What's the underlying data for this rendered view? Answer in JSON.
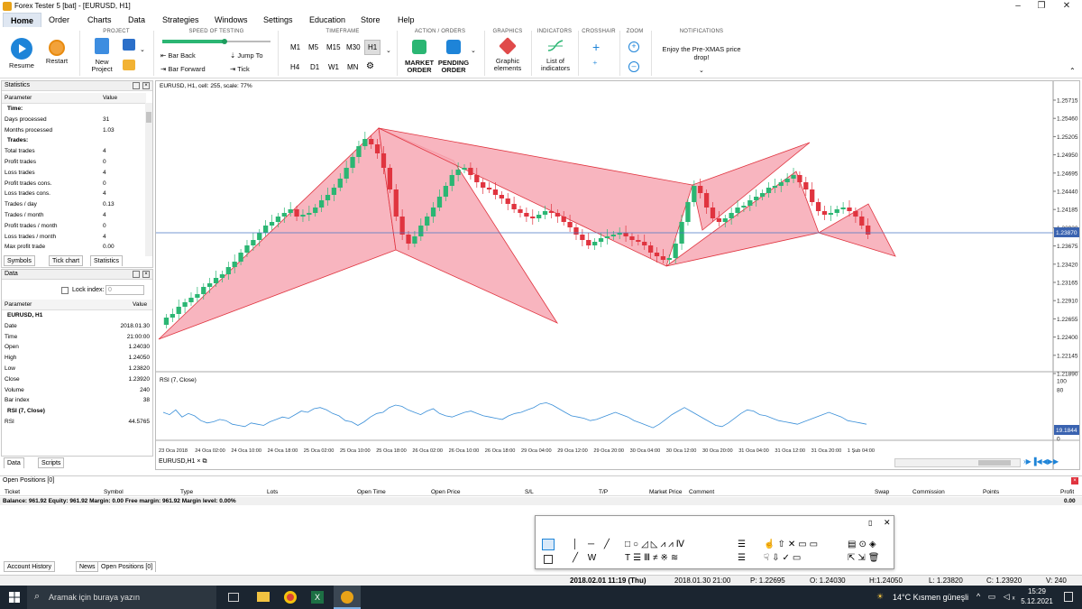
{
  "window": {
    "title": "Forex Tester 5  [bat] - [EURUSD, H1]"
  },
  "menu": [
    "Home",
    "Order",
    "Charts",
    "Data",
    "Strategies",
    "Windows",
    "Settings",
    "Education",
    "Store",
    "Help"
  ],
  "ribbon": {
    "groups": {
      "project": "PROJECT",
      "speed": "SPEED OF TESTING",
      "timeframe": "TIMEFRAME",
      "action": "ACTION / ORDERS",
      "graphics": "GRAPHICS",
      "indicators": "INDICATORS",
      "crosshair": "CROSSHAIR",
      "zoom": "ZOOM",
      "notifications": "NOTIFICATIONS"
    },
    "resume": "Resume",
    "restart": "Restart",
    "new_project": [
      "New",
      "Project"
    ],
    "bar_back": "Bar Back",
    "bar_forward": "Bar Forward",
    "jump_to": "Jump To",
    "tick": "Tick",
    "timeframes_row1": [
      "M1",
      "M5",
      "M15",
      "M30",
      "H1"
    ],
    "timeframes_row2": [
      "H4",
      "D1",
      "W1",
      "MN"
    ],
    "market_order": [
      "MARKET",
      "ORDER"
    ],
    "pending_order": [
      "PENDING",
      "ORDER"
    ],
    "graphic_elements": [
      "Graphic",
      "elements"
    ],
    "list_indicators": [
      "List of",
      "indicators"
    ],
    "notification": [
      "Enjoy the Pre-XMAS price",
      "drop!"
    ]
  },
  "statistics": {
    "title": "Statistics",
    "col_param": "Parameter",
    "col_value": "Value",
    "rows": [
      {
        "k": "Time:",
        "v": "",
        "h": true
      },
      {
        "k": "Days processed",
        "v": "31"
      },
      {
        "k": "Months processed",
        "v": "1.03"
      },
      {
        "k": "Trades:",
        "v": "",
        "h": true
      },
      {
        "k": "Total trades",
        "v": "4"
      },
      {
        "k": "Profit trades",
        "v": "0"
      },
      {
        "k": "Loss trades",
        "v": "4"
      },
      {
        "k": "Profit trades cons.",
        "v": "0"
      },
      {
        "k": "Loss trades cons.",
        "v": "4"
      },
      {
        "k": "Trades / day",
        "v": "0.13"
      },
      {
        "k": "Trades / month",
        "v": "4"
      },
      {
        "k": "Profit trades / month",
        "v": "0"
      },
      {
        "k": "Loss trades / month",
        "v": "4"
      },
      {
        "k": "Max profit trade",
        "v": "0.00"
      }
    ],
    "tabs": [
      "Symbols",
      "Tick chart",
      "Statistics"
    ]
  },
  "data_panel": {
    "title": "Data",
    "lock_label": "Lock index:",
    "lock_value": "0",
    "col_param": "Parameter",
    "col_value": "Value",
    "rows": [
      {
        "k": "EURUSD, H1",
        "v": "",
        "h": true
      },
      {
        "k": "Date",
        "v": "2018.01.30"
      },
      {
        "k": "Time",
        "v": "21:00:00"
      },
      {
        "k": "Open",
        "v": "1.24030"
      },
      {
        "k": "High",
        "v": "1.24050"
      },
      {
        "k": "Low",
        "v": "1.23820"
      },
      {
        "k": "Close",
        "v": "1.23920"
      },
      {
        "k": "Volume",
        "v": "240"
      },
      {
        "k": "Bar index",
        "v": "38"
      },
      {
        "k": "RSI (7, Close)",
        "v": "",
        "h": true
      },
      {
        "k": "RSI",
        "v": "44.5765"
      }
    ],
    "tabs": [
      "Data",
      "Scripts"
    ]
  },
  "chart": {
    "label": "EURUSD, H1, cell: 255, scale: 77%",
    "price_ticks": [
      "1.25715",
      "1.25460",
      "1.25205",
      "1.24950",
      "1.24695",
      "1.24440",
      "1.24185",
      "1.23930",
      "1.23675",
      "1.23420",
      "1.23165",
      "1.22910",
      "1.22655",
      "1.22400",
      "1.22145",
      "1.21890"
    ],
    "current_price": "1.23870",
    "rsi_label": "RSI (7, Close)",
    "rsi_ticks": [
      "100",
      "80",
      "0"
    ],
    "rsi_value": "19.1844",
    "time_ticks": [
      "23 Oca 2018",
      "24 Oca 02:00",
      "24 Oca 10:00",
      "24 Oca 18:00",
      "25 Oca 02:00",
      "25 Oca 10:00",
      "25 Oca 18:00",
      "26 Oca 02:00",
      "26 Oca 10:00",
      "26 Oca 18:00",
      "29 Oca 04:00",
      "29 Oca 12:00",
      "29 Oca 20:00",
      "30 Oca 04:00",
      "30 Oca 12:00",
      "30 Oca 20:00",
      "31 Oca 04:00",
      "31 Oca 12:00",
      "31 Oca 20:00",
      "1 Şub 04:00"
    ],
    "tab": "EURUSD,H1"
  },
  "positions": {
    "title": "Open Positions [0]",
    "columns": [
      "Ticket",
      "Symbol",
      "Type",
      "Lots",
      "Open Time",
      "Open Price",
      "S/L",
      "T/P",
      "Market Price",
      "Comment",
      "Swap",
      "Commission",
      "Points",
      "Profit"
    ],
    "balance": "Balance: 961.92 Equity: 961.92 Margin: 0.00 Free margin: 961.92 Margin level: 0.00%",
    "profit": "0.00",
    "tabs": [
      "Account History",
      "News",
      "Open Positions [0]"
    ]
  },
  "status": {
    "datetime": "2018.02.01 11:19 (Thu)",
    "bar_time": "2018.01.30 21:00",
    "p": "P: 1.22695",
    "o": "O: 1.24030",
    "h": "H:1.24050",
    "l": "L: 1.23820",
    "c": "C: 1.23920",
    "v": "V: 240"
  },
  "taskbar": {
    "search": "Aramak için buraya yazın",
    "weather": "14°C  Kısmen güneşli",
    "time": "15:29",
    "date": "5.12.2021"
  },
  "colors": {
    "pattern_fill": "#f7a8b4",
    "pattern_stroke": "#e0343f",
    "bull": "#2bb673",
    "bear": "#e0343f",
    "rsi": "#3a8fd8",
    "price_line": "#4a77c4"
  }
}
